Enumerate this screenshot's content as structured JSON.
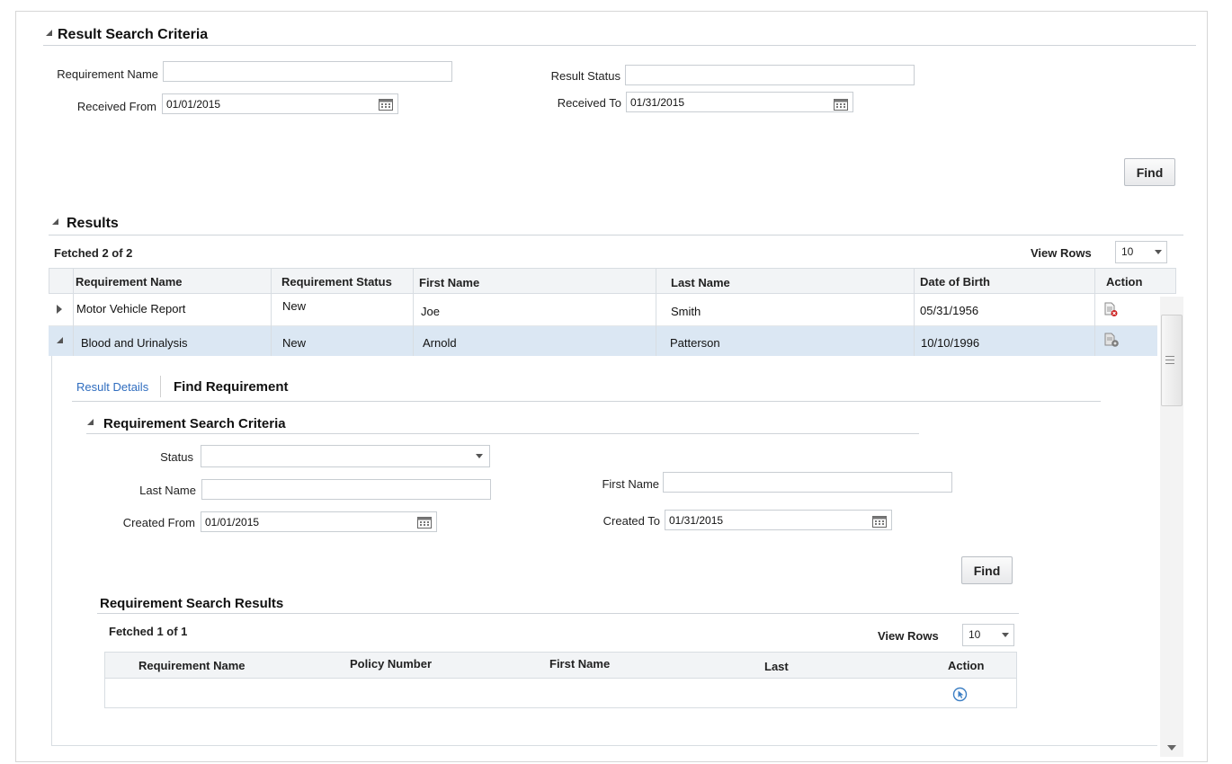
{
  "result_search": {
    "title": "Result Search Criteria",
    "requirement_name_label": "Requirement Name",
    "requirement_name_value": "",
    "result_status_label": "Result Status",
    "result_status_value": "",
    "received_from_label": "Received From",
    "received_from_value": "01/01/2015",
    "received_to_label": "Received To",
    "received_to_value": "01/31/2015",
    "find_label": "Find"
  },
  "results": {
    "title": "Results",
    "fetched": "Fetched 2 of 2",
    "view_rows_label": "View Rows",
    "view_rows_value": "10",
    "columns": [
      "Requirement Name",
      "Requirement Status",
      "First Name",
      "Last Name",
      "Date of Birth",
      "Action"
    ],
    "rows": [
      {
        "requirement": "Motor Vehicle Report",
        "status": "New",
        "first": "Joe",
        "last": "Smith",
        "dob": "05/31/1956",
        "action_icon": "document-delete-icon"
      },
      {
        "requirement": "Blood and Urinalysis",
        "status": "New",
        "first": "Arnold",
        "last": "Patterson",
        "dob": "10/10/1996",
        "action_icon": "document-settings-icon"
      }
    ]
  },
  "detail": {
    "tab_result_details": "Result Details",
    "tab_find_requirement": "Find Requirement",
    "criteria_title": "Requirement Search Criteria",
    "status_label": "Status",
    "status_value": "",
    "last_name_label": "Last Name",
    "last_name_value": "",
    "first_name_label": "First Name",
    "first_name_value": "",
    "created_from_label": "Created From",
    "created_from_value": "01/01/2015",
    "created_to_label": "Created To",
    "created_to_value": "01/31/2015",
    "find_label": "Find",
    "search_results_title": "Requirement Search Results",
    "fetched": "Fetched 1 of 1",
    "view_rows_label": "View Rows",
    "view_rows_value": "10",
    "columns": [
      "Requirement Name",
      "Policy Number",
      "First Name",
      "Last",
      "Action"
    ]
  },
  "colors": {
    "selected_row": "#dbe7f3",
    "header_row": "#f2f4f6",
    "link": "#2f6dbf"
  }
}
